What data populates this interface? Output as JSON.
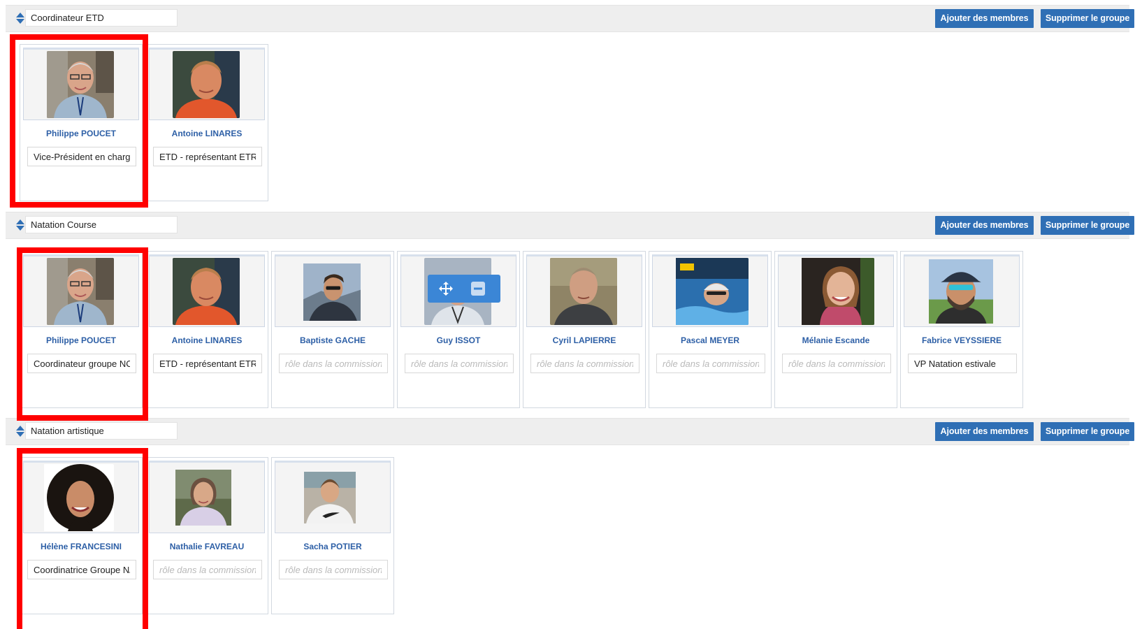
{
  "groups": [
    {
      "name": "Coordinateur ETD",
      "add_label": "Ajouter des membres",
      "delete_label": "Supprimer le groupe",
      "members": [
        {
          "name": "Philippe POUCET",
          "role": "Vice-Président en charg",
          "placeholder": "rôle dans la commission"
        },
        {
          "name": "Antoine LINARES",
          "role": "ETD - représentant ETR",
          "placeholder": "rôle dans la commission"
        }
      ]
    },
    {
      "name": "Natation Course",
      "add_label": "Ajouter des membres",
      "delete_label": "Supprimer le groupe",
      "members": [
        {
          "name": "Philippe POUCET",
          "role": "Coordinateur groupe NC",
          "placeholder": "rôle dans la commission"
        },
        {
          "name": "Antoine LINARES",
          "role": "ETD - représentant ETR",
          "placeholder": "rôle dans la commission"
        },
        {
          "name": "Baptiste GACHE",
          "role": "",
          "placeholder": "rôle dans la commission"
        },
        {
          "name": "Guy ISSOT",
          "role": "",
          "placeholder": "rôle dans la commission"
        },
        {
          "name": "Cyril LAPIERRE",
          "role": "",
          "placeholder": "rôle dans la commission"
        },
        {
          "name": "Pascal MEYER",
          "role": "",
          "placeholder": "rôle dans la commission"
        },
        {
          "name": "Mélanie Escande",
          "role": "",
          "placeholder": "rôle dans la commission"
        },
        {
          "name": "Fabrice VEYSSIERE",
          "role": "VP Natation estivale",
          "placeholder": "rôle dans la commission"
        }
      ]
    },
    {
      "name": "Natation artistique",
      "add_label": "Ajouter des membres",
      "delete_label": "Supprimer le groupe",
      "members": [
        {
          "name": "Hélène FRANCESINI",
          "role": "Coordinatrice Groupe N/",
          "placeholder": "rôle dans la commission"
        },
        {
          "name": "Nathalie FAVREAU",
          "role": "",
          "placeholder": "rôle dans la commission"
        },
        {
          "name": "Sacha POTIER",
          "role": "",
          "placeholder": "rôle dans la commission"
        }
      ]
    }
  ],
  "icons": {
    "sort": "sort-arrows-icon",
    "move": "move-arrows-icon",
    "remove": "minus-icon"
  },
  "colors": {
    "accent": "#2f6fb5",
    "name_link": "#2d5fa6",
    "highlight": "#ff0000",
    "header_bar": "#eeeeee",
    "hover_toolbar": "#3b86d6"
  }
}
